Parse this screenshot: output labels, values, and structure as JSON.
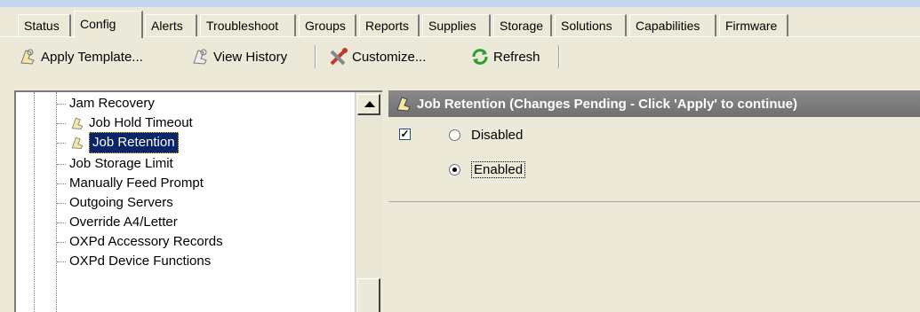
{
  "tabs": [
    "Status",
    "Config",
    "Alerts",
    "Troubleshoot",
    "Groups",
    "Reports",
    "Supplies",
    "Storage",
    "Solutions",
    "Capabilities",
    "Firmware"
  ],
  "active_tab": "Config",
  "toolbar": {
    "apply_template": "Apply Template...",
    "view_history": "View History",
    "customize": "Customize...",
    "refresh": "Refresh"
  },
  "tree": {
    "items": [
      {
        "label": "Jam Recovery",
        "icon": null
      },
      {
        "label": "Job Hold Timeout",
        "icon": "hand-icon"
      },
      {
        "label": "Job Retention",
        "icon": "hand-icon",
        "selected": true
      },
      {
        "label": "Job Storage Limit",
        "icon": null
      },
      {
        "label": "Manually Feed Prompt",
        "icon": null
      },
      {
        "label": "Outgoing Servers",
        "icon": null
      },
      {
        "label": "Override A4/Letter",
        "icon": null
      },
      {
        "label": "OXPd Accessory Records",
        "icon": null
      },
      {
        "label": "OXPd Device Functions",
        "icon": null
      }
    ]
  },
  "panel": {
    "title": "Job Retention (Changes Pending - Click 'Apply' to continue)",
    "checkbox_checked": true,
    "options": [
      {
        "label": "Disabled",
        "selected": false
      },
      {
        "label": "Enabled",
        "selected": true
      }
    ]
  }
}
